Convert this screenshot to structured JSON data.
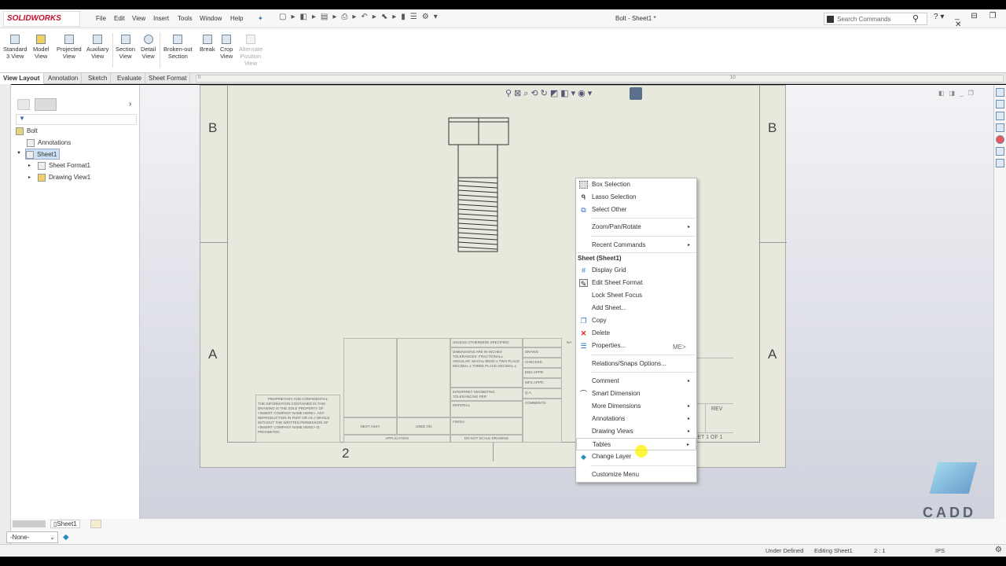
{
  "app": {
    "brand": "SOLIDWORKS",
    "title": "Bolt - Sheet1 *",
    "search_placeholder": "Search Commands"
  },
  "menu": [
    "File",
    "Edit",
    "View",
    "Insert",
    "Tools",
    "Window",
    "Help"
  ],
  "ribbon": [
    {
      "label": "Standard\n3 View",
      "enabled": true
    },
    {
      "label": "Model\nView",
      "enabled": true
    },
    {
      "label": "Projected\nView",
      "enabled": true
    },
    {
      "label": "Auxiliary\nView",
      "enabled": true
    },
    {
      "label": "Section\nView",
      "enabled": true
    },
    {
      "label": "Detail\nView",
      "enabled": true
    },
    {
      "label": "Broken-out\nSection",
      "enabled": true
    },
    {
      "label": "Break",
      "enabled": true
    },
    {
      "label": "Crop\nView",
      "enabled": true
    },
    {
      "label": "Alternate\nPosition\nView",
      "enabled": false
    }
  ],
  "tabs": [
    "View Layout",
    "Annotation",
    "Sketch",
    "Evaluate",
    "Sheet Format"
  ],
  "ruler": {
    "start": "0",
    "mid": "10"
  },
  "tree": {
    "root": "Bolt",
    "items": [
      "Annotations",
      "Sheet1",
      "Sheet Format1",
      "Drawing View1"
    ]
  },
  "sheet": {
    "zones_left": [
      "B",
      "A"
    ],
    "zones_right": [
      "B",
      "A"
    ],
    "bottom_zone": "2",
    "name_partial": "ME>",
    "rev": "REV",
    "sheet_of": "SHEET 1 OF 1"
  },
  "title_block": {
    "unless": "UNLESS OTHERWISE SPECIFIED:",
    "dims": "DIMENSIONS ARE IN INCHES TOLERANCES: FRACTIONAL± ANGULAR: MACH±  BEND ± TWO PLACE DECIMAL  ± THREE PLACE DECIMAL ±",
    "interpret": "INTERPRET GEOMETRIC TOLERANCING PER:",
    "material": "MATERIAL",
    "finish": "FINISH",
    "do_not_scale": "DO NOT SCALE DRAWING",
    "next_assy": "NEXT ASSY",
    "used_on": "USED ON",
    "application": "APPLICATION",
    "na": "NA",
    "rows": [
      "DRAWN",
      "CHECKED",
      "ENG APPR.",
      "MFG APPR.",
      "Q.A.",
      "COMMENTS:"
    ],
    "prop_title": "PROPRIETARY AND CONFIDENTIAL",
    "prop_text": "THE INFORMATION CONTAINED IN THIS DRAWING IS THE SOLE PROPERTY OF <INSERT COMPANY NAME HERE>. ANY REPRODUCTION IN PART OR AS A WHOLE WITHOUT THE WRITTEN PERMISSION OF <INSERT COMPANY NAME HERE> IS PROHIBITED."
  },
  "context_menu": {
    "items": [
      {
        "label": "Box Selection",
        "icon": "box-select-icon",
        "submenu": false
      },
      {
        "label": "Lasso Selection",
        "icon": "lasso-icon",
        "submenu": false
      },
      {
        "label": "Select Other",
        "icon": "select-other-icon",
        "submenu": false
      },
      {
        "label": "Zoom/Pan/Rotate",
        "submenu": true
      },
      {
        "label": "Recent Commands",
        "submenu": true
      },
      {
        "label": "Display Grid",
        "icon": "grid-icon",
        "submenu": false
      },
      {
        "label": "Edit Sheet Format",
        "icon": "edit-sheet-format-icon",
        "submenu": false
      },
      {
        "label": "Lock Sheet Focus",
        "submenu": false
      },
      {
        "label": "Add Sheet...",
        "submenu": false
      },
      {
        "label": "Copy",
        "icon": "copy-icon",
        "submenu": false
      },
      {
        "label": "Delete",
        "icon": "delete-icon",
        "submenu": false
      },
      {
        "label": "Properties...",
        "icon": "properties-icon",
        "submenu": false
      },
      {
        "label": "Relations/Snaps Options...",
        "submenu": false
      },
      {
        "label": "Comment",
        "submenu": true
      },
      {
        "label": "Smart Dimension",
        "icon": "smart-dimension-icon",
        "submenu": false
      },
      {
        "label": "More Dimensions",
        "submenu": true
      },
      {
        "label": "Annotations",
        "submenu": true
      },
      {
        "label": "Drawing Views",
        "submenu": true
      },
      {
        "label": "Tables",
        "submenu": true
      },
      {
        "label": "Change Layer",
        "icon": "layer-icon",
        "submenu": false
      },
      {
        "label": "Customize Menu",
        "submenu": false
      }
    ],
    "section_header": "Sheet (Sheet1)"
  },
  "bottom": {
    "sheet_tab": "Sheet1",
    "layer": "-None-"
  },
  "status": {
    "state": "Under Defined",
    "mode": "Editing Sheet1",
    "scale": "2 : 1",
    "units": "IPS"
  },
  "watermark": "CADD"
}
